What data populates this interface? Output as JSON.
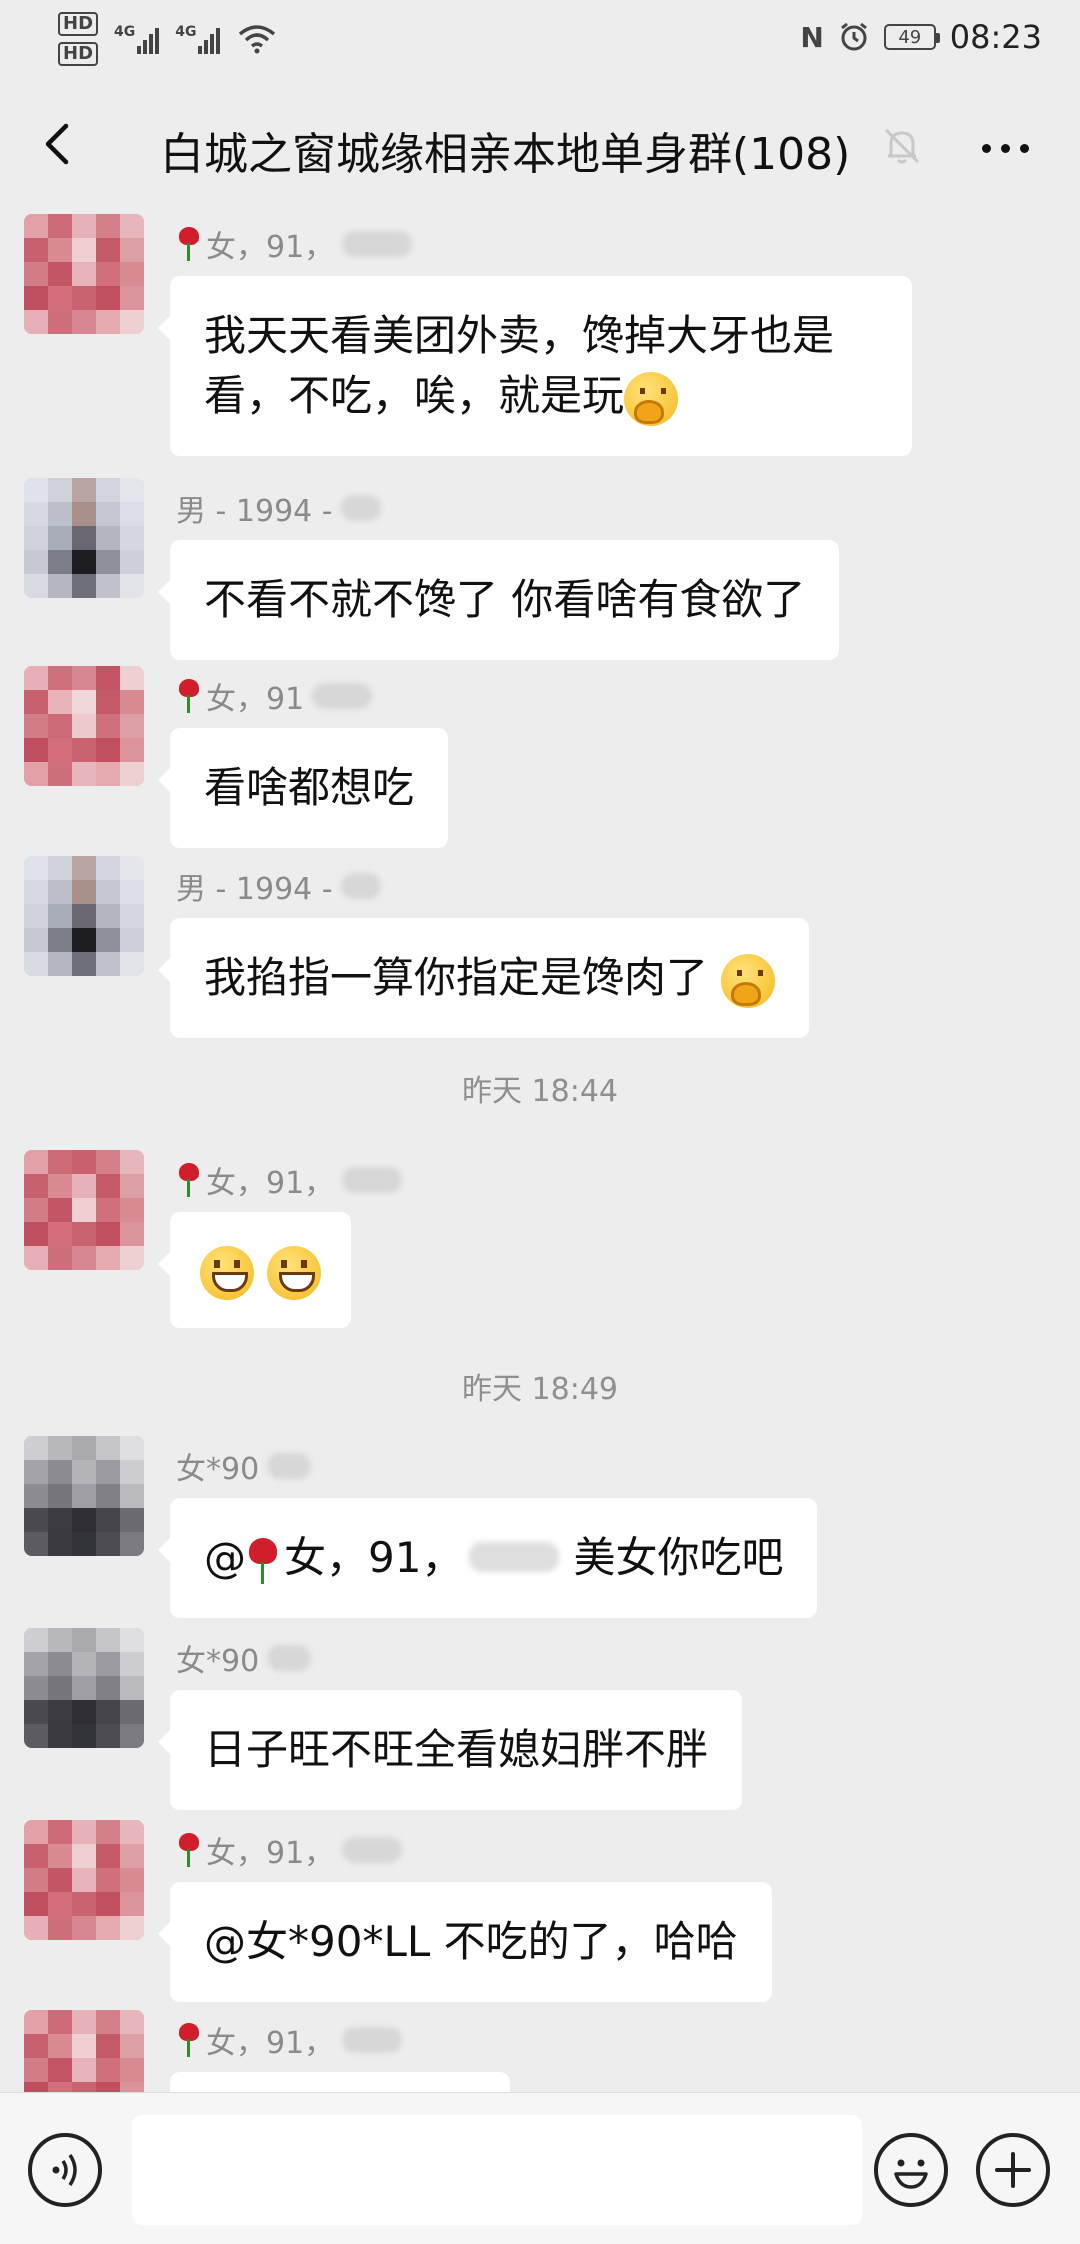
{
  "status_bar": {
    "hd1": "HD",
    "hd2": "HD",
    "net1": "4G",
    "net2": "4G",
    "nfc": "N",
    "battery": "49",
    "time": "08:23"
  },
  "header": {
    "title": "白城之窗城缘相亲本地单身群(108)"
  },
  "messages": [
    {
      "sender": "女，91，",
      "text": "我天天看美团外卖，馋掉大牙也是看，不吃，唉，就是玩"
    },
    {
      "sender": "男 - 1994 -",
      "text": "不看不就不馋了 你看啥有食欲了"
    },
    {
      "sender": "女，91",
      "text": "看啥都想吃"
    },
    {
      "sender": "男 - 1994 -",
      "text": "我掐指一算你指定是馋肉了 "
    },
    {
      "sender": "女，91，",
      "text": ""
    },
    {
      "sender": "女*90",
      "text_pre": "@",
      "text_mid": "女，91，",
      "text_post": "美女你吃吧"
    },
    {
      "sender": "女*90",
      "text": "日子旺不旺全看媳妇胖不胖"
    },
    {
      "sender": "女，91，",
      "text": "@女*90*LL  不吃的了，哈哈"
    },
    {
      "sender": "女，91，",
      "text": ""
    }
  ],
  "timestamps": [
    "昨天 18:44",
    "昨天 18:49"
  ],
  "icons": {
    "back": "chevron-left-icon",
    "mute": "bell-off-icon",
    "more": "more-dots-icon",
    "voice": "voice-icon",
    "emoji": "emoji-icon",
    "add": "plus-icon"
  },
  "colors": {
    "background": "#ededed",
    "bubble": "#ffffff",
    "meta_text": "#8a8a8a"
  }
}
